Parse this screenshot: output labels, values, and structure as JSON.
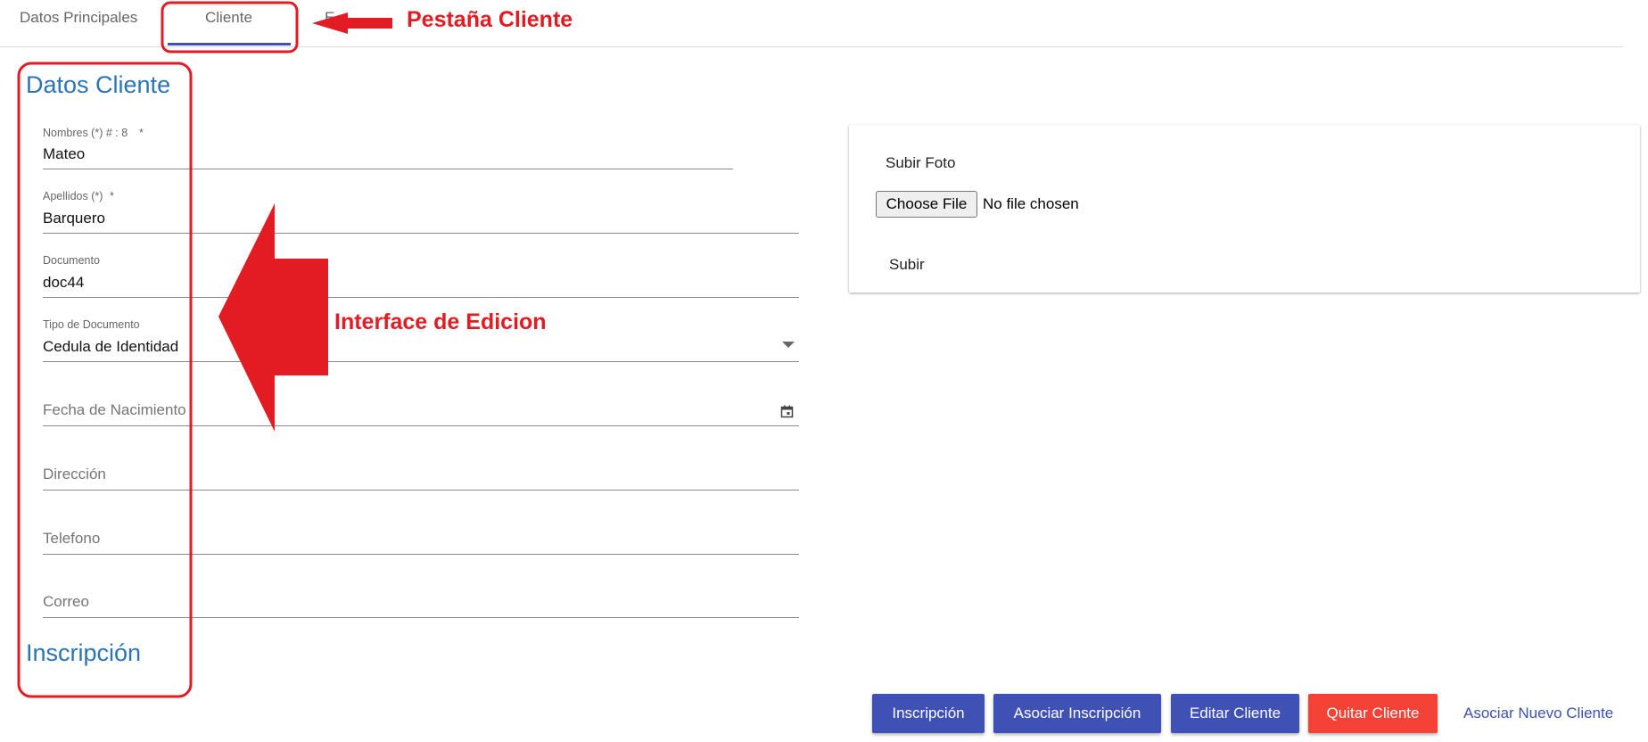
{
  "tabs": [
    {
      "label": "Datos Principales"
    },
    {
      "label": "Cliente"
    },
    {
      "label": "E"
    }
  ],
  "sections": {
    "datos_cliente": "Datos Cliente",
    "inscripcion": "Inscripción"
  },
  "fields": {
    "nombres": {
      "label": "Nombres (*) # : 8",
      "required_mark": "*",
      "value": "Mateo"
    },
    "apellidos": {
      "label": "Apellidos (*)",
      "required_mark": "*",
      "value": "Barquero"
    },
    "documento": {
      "label": "Documento",
      "value": "doc44"
    },
    "tipo_documento": {
      "label": "Tipo de Documento",
      "value": "Cedula de Identidad"
    },
    "fecha_nacimiento": {
      "placeholder": "Fecha de Nacimiento"
    },
    "direccion": {
      "placeholder": "Dirección"
    },
    "telefono": {
      "placeholder": "Telefono"
    },
    "correo": {
      "placeholder": "Correo"
    }
  },
  "upload": {
    "title": "Subir Foto",
    "choose_file": "Choose File",
    "no_file": "No file chosen",
    "submit": "Subir"
  },
  "actions": {
    "inscripcion": "Inscripción",
    "asociar_inscripcion": "Asociar Inscripción",
    "editar_cliente": "Editar Cliente",
    "quitar_cliente": "Quitar Cliente",
    "asociar_nuevo_cliente": "Asociar Nuevo Cliente"
  },
  "annotations": {
    "tab_label": "Pestaña Cliente",
    "interface_label": "Interface de Edicion"
  },
  "colors": {
    "primary": "#3f51b5",
    "danger": "#f44336",
    "section_title": "#2b74b5",
    "annotation": "#e31b23"
  }
}
